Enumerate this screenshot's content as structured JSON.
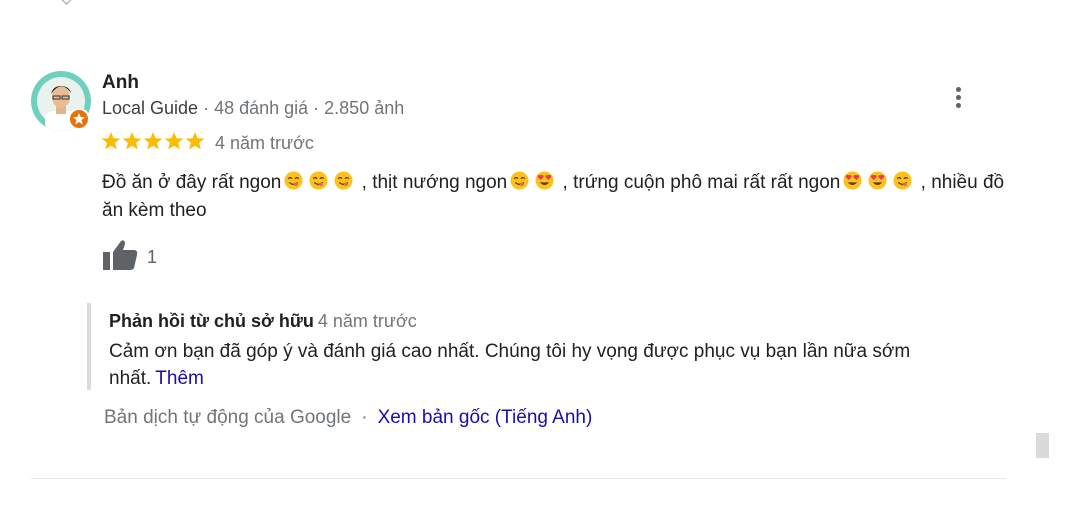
{
  "review": {
    "author": "Anh",
    "badge": "Local Guide",
    "meta_rest": " · 48 đánh giá · 2.850 ảnh",
    "rating": 5,
    "time": "4 năm trước",
    "text": {
      "p1": "Đồ ăn ở đây rất ngon",
      "p2": " , thịt nướng ngon",
      "p3": " , trứng cuộn phô mai rất rất ngon",
      "p4": " , nhiều đồ ăn kèm theo"
    },
    "likes": "1"
  },
  "owner_reply": {
    "label": "Phản hồi từ chủ sở hữu",
    "time": "4 năm trước",
    "text": "Cảm ơn bạn đã góp ý và đánh giá cao nhất. Chúng tôi hy vọng được phục vụ bạn lần nữa sớm nhất.",
    "more": "Thêm"
  },
  "translation": {
    "note": "Bản dịch tự động của Google",
    "separator": "·",
    "link": "Xem bản gốc (Tiếng Anh)"
  },
  "icons": {
    "more": "more-vert-icon",
    "like": "thumbs-up-icon",
    "star": "star-icon",
    "badge": "local-guide-badge-icon"
  },
  "colors": {
    "star": "#fbbc04",
    "link": "#1a0dab",
    "badge": "#e8710a",
    "secondary_text": "#70757a"
  }
}
